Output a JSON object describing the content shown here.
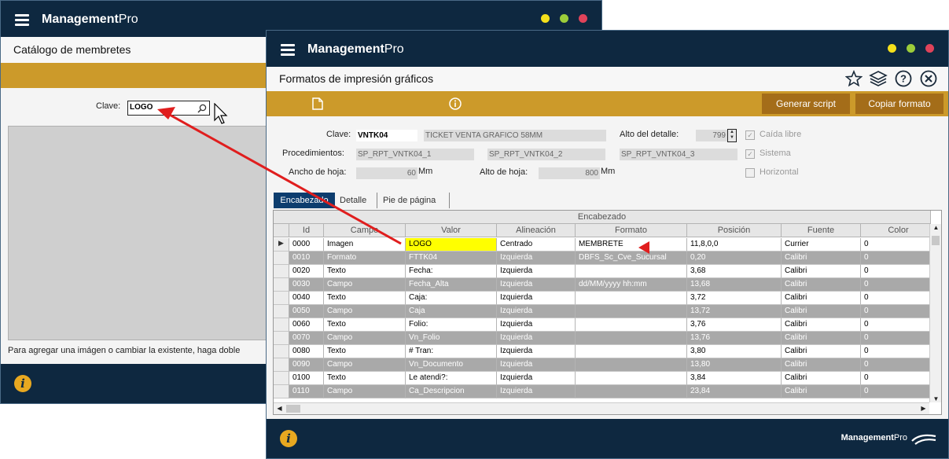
{
  "window_back": {
    "brand": "Management",
    "brand_pro": "Pro",
    "title": "Catálogo de membretes",
    "clave_label": "Clave:",
    "clave_value": "LOGO",
    "hint": "Para agregar una imágen o cambiar la existente, haga doble"
  },
  "window_front": {
    "brand": "Management",
    "brand_pro": "Pro",
    "title": "Formatos de impresión gráficos",
    "buttons": {
      "generar": "Generar script",
      "copiar": "Copiar formato"
    },
    "form": {
      "clave_label": "Clave:",
      "clave_value": "VNTK04",
      "descripcion": "TICKET VENTA GRAFICO 58MM",
      "alto_detalle_label": "Alto del detalle:",
      "alto_detalle_value": "799",
      "procedimientos_label": "Procedimientos:",
      "proc1": "SP_RPT_VNTK04_1",
      "proc2": "SP_RPT_VNTK04_2",
      "proc3": "SP_RPT_VNTK04_3",
      "ancho_label": "Ancho de hoja:",
      "ancho_value": "60",
      "ancho_unit": "Mm",
      "alto_hoja_label": "Alto de hoja:",
      "alto_hoja_value": "800",
      "alto_hoja_unit": "Mm",
      "caida_libre": "Caída libre",
      "sistema": "Sistema",
      "horizontal": "Horizontal"
    },
    "tabs": [
      "Encabezado",
      "Detalle",
      "Pie de página"
    ],
    "grid": {
      "group_title": "Encabezado",
      "columns": [
        "Id",
        "Campo",
        "Valor",
        "Alineación",
        "Formato",
        "Posición",
        "Fuente",
        "Color"
      ],
      "rows": [
        [
          "0000",
          "Imagen",
          "LOGO",
          "Centrado",
          "MEMBRETE",
          "11,8,0,0",
          "Currier",
          "0"
        ],
        [
          "0010",
          "Formato",
          "FTTK04",
          "Izquierda",
          "DBFS_Sc_Cve_Sucursal",
          "0,20",
          "Calibri",
          "0"
        ],
        [
          "0020",
          "Texto",
          "Fecha:",
          "Izquierda",
          "",
          "3,68",
          "Calibri",
          "0"
        ],
        [
          "0030",
          "Campo",
          "Fecha_Alta",
          "Izquierda",
          "dd/MM/yyyy hh:mm",
          "13,68",
          "Calibri",
          "0"
        ],
        [
          "0040",
          "Texto",
          "Caja:",
          "Izquierda",
          "",
          "3,72",
          "Calibri",
          "0"
        ],
        [
          "0050",
          "Campo",
          "Caja",
          "Izquierda",
          "",
          "13,72",
          "Calibri",
          "0"
        ],
        [
          "0060",
          "Texto",
          "Folio:",
          "Izquierda",
          "",
          "3,76",
          "Calibri",
          "0"
        ],
        [
          "0070",
          "Campo",
          "Vn_Folio",
          "Izquierda",
          "",
          "13,76",
          "Calibri",
          "0"
        ],
        [
          "0080",
          "Texto",
          "# Tran:",
          "Izquierda",
          "",
          "3,80",
          "Calibri",
          "0"
        ],
        [
          "0090",
          "Campo",
          "Vn_Documento",
          "Izquierda",
          "",
          "13,80",
          "Calibri",
          "0"
        ],
        [
          "0100",
          "Texto",
          "Le atendi?:",
          "Izquierda",
          "",
          "3,84",
          "Calibri",
          "0"
        ],
        [
          "0110",
          "Campo",
          "Ca_Descripcion",
          "Izquierda",
          "",
          "23,84",
          "Calibri",
          "0"
        ]
      ]
    },
    "footer_brand": "Management",
    "footer_brand_pro": "Pro"
  },
  "colors": {
    "titlebar": "#0e2840",
    "gold": "#cc9a2a",
    "button": "#a46d19",
    "highlight": "#ffff00",
    "arrow": "#e01e1e"
  }
}
